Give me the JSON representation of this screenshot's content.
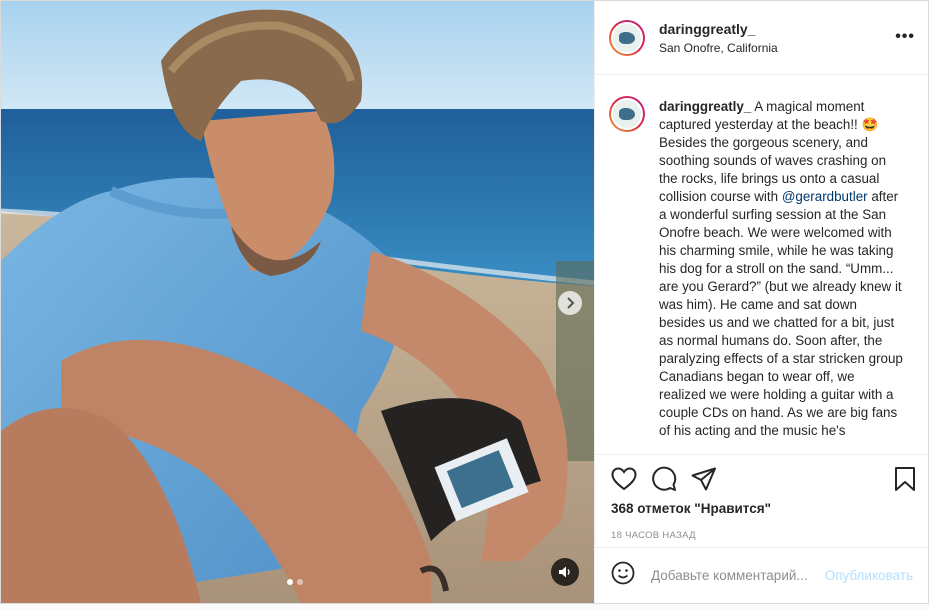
{
  "post": {
    "username": "daringgreatly_",
    "location": "San Onofre, California",
    "more_label": "•••",
    "caption": {
      "username": "daringgreatly_",
      "text_before": " A magical moment captured yesterday at the beach!! 🤩 Besides the gorgeous scenery, and soothing sounds of waves crashing on the rocks, life brings us onto a casual collision course with ",
      "mention": "@gerardbutler",
      "text_after": " after a wonderful surfing session at the San Onofre beach. We were welcomed with his charming smile, while he was taking his dog for a stroll on the sand. “Umm... are you Gerard?” (but we already knew it was him). He came and sat down besides us and we chatted for a bit, just as normal humans do. Soon after, the paralyzing effects of a star stricken group Canadians began to wear off, we realized we were holding a guitar with a couple CDs on hand. As we are big fans of his acting and the music he's"
    },
    "likes": "368 отметок \"Нравится\"",
    "time": "18 часов назад",
    "comment_placeholder": "Добавьте комментарий...",
    "publish_label": "Опубликовать",
    "carousel": {
      "slides": 2,
      "active": 1
    }
  },
  "icons": {
    "like": "heart-icon",
    "comment": "comment-icon",
    "share": "share-icon",
    "save": "bookmark-icon",
    "emoji": "emoji-icon",
    "next": "chevron-right-icon",
    "sound": "speaker-icon"
  },
  "colors": {
    "link": "#00376b",
    "publish_disabled": "#b2dffc",
    "muted": "#8e8e8e"
  }
}
